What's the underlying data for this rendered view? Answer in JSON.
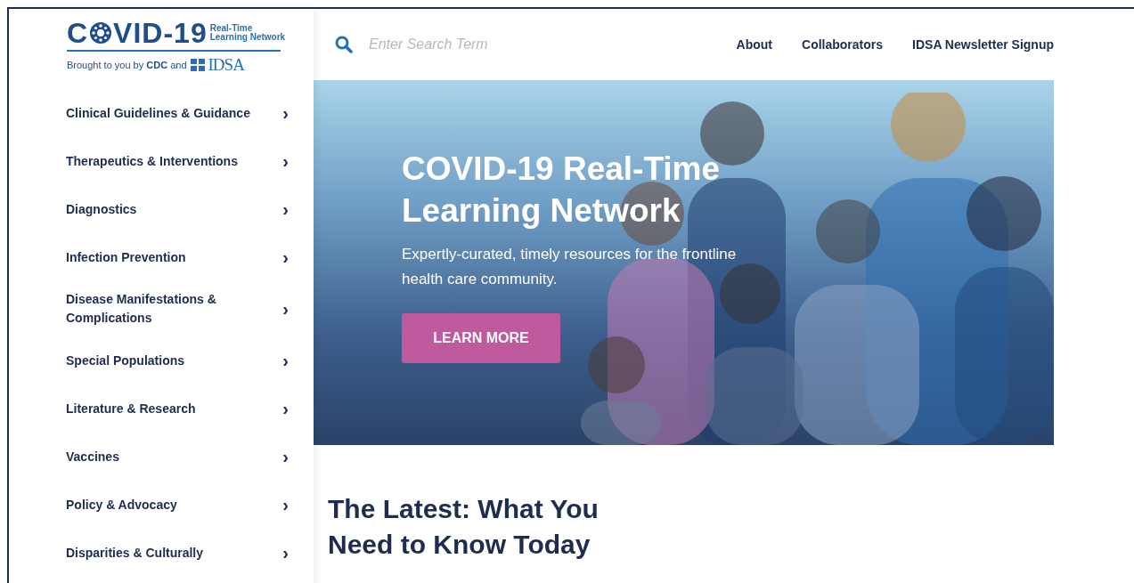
{
  "logo": {
    "lead": "C",
    "title": "VID-19",
    "tagline": [
      "Real-Time",
      "Learning Network"
    ],
    "credit": "Brought to you by **CDC** and",
    "partner": "IDSA"
  },
  "sidebar": {
    "items": [
      {
        "label": "Clinical Guidelines & Guidance",
        "chevron": "›"
      },
      {
        "label": "Therapeutics & Interventions",
        "chevron": "›"
      },
      {
        "label": "Diagnostics",
        "chevron": "›"
      },
      {
        "label": "Infection Prevention",
        "chevron": "›"
      },
      {
        "label": "Disease Manifestations & Complications",
        "chevron": "›"
      },
      {
        "label": "Special Populations",
        "chevron": "›"
      },
      {
        "label": "Literature & Research",
        "chevron": "›"
      },
      {
        "label": "Vaccines",
        "chevron": "›"
      },
      {
        "label": "Policy & Advocacy",
        "chevron": "›"
      },
      {
        "label": "Disparities & Culturally",
        "chevron": "›"
      }
    ]
  },
  "search": {
    "placeholder": "Enter Search Term"
  },
  "nav": [
    "About",
    "Collaborators",
    "IDSA Newsletter Signup"
  ],
  "hero": {
    "title": "COVID-19 Real-Time Learning Network",
    "subtitle": "Expertly-curated, timely resources for the frontline health care community.",
    "button": "LEARN MORE"
  },
  "latest": {
    "heading": "The Latest: What You Need to Know Today"
  }
}
